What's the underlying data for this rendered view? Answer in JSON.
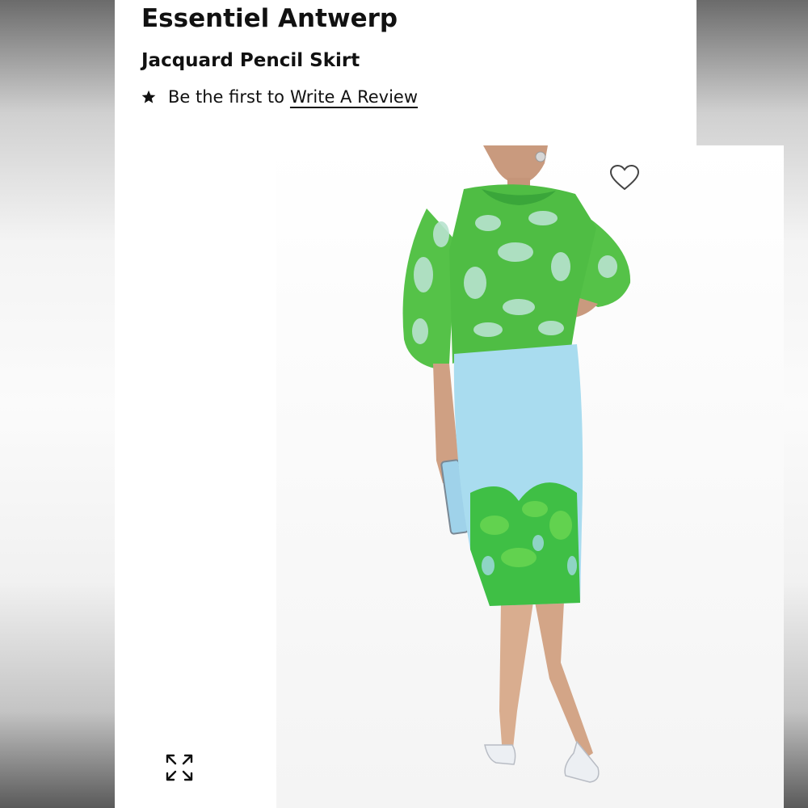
{
  "product": {
    "brand": "Essentiel Antwerp",
    "name": "Jacquard Pencil Skirt",
    "review_prompt": "Be the first to",
    "review_link": "Write A Review"
  },
  "icons": {
    "rating": "star-icon",
    "favorite": "heart-icon",
    "zoom": "expand-icon"
  },
  "colors": {
    "sweater_green": "#55c248",
    "skirt_blue": "#a9dcef",
    "hem_green": "#3fbf45"
  }
}
